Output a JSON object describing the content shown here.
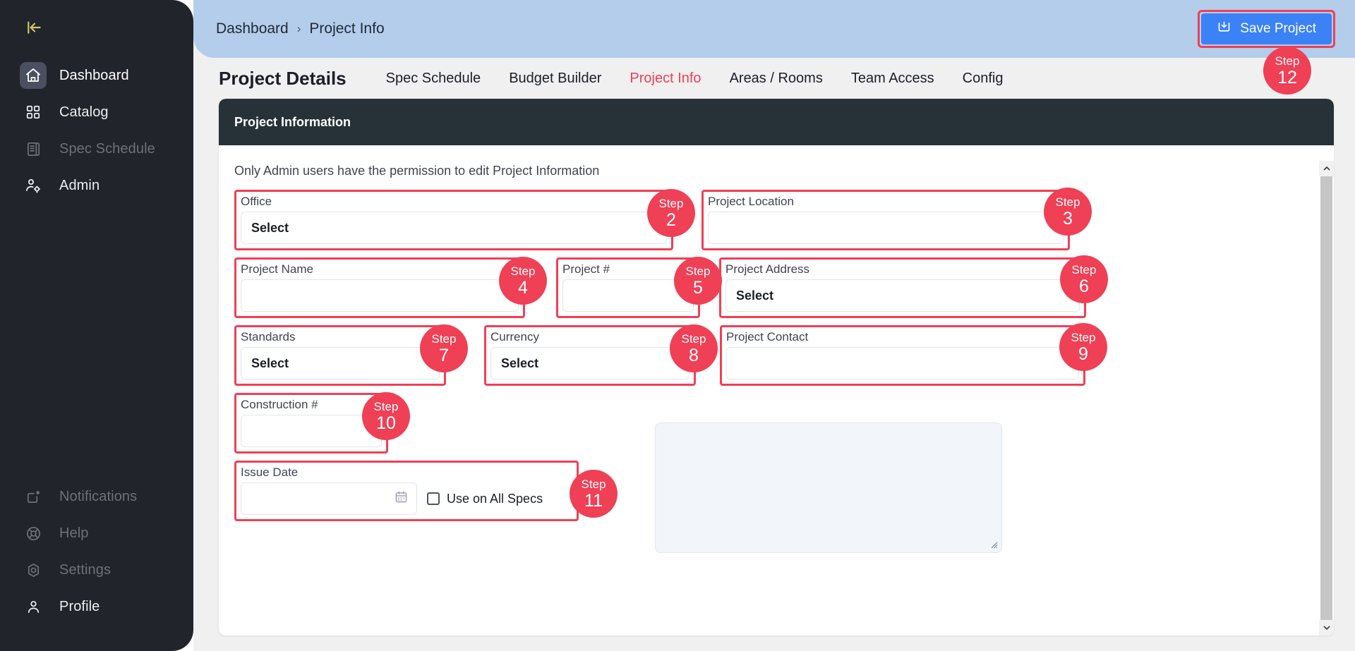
{
  "sidebar": {
    "collapse_icon": "collapse-panel-icon",
    "top_items": [
      {
        "label": "Dashboard",
        "icon": "home-icon",
        "state": "active"
      },
      {
        "label": "Catalog",
        "icon": "grid-icon",
        "state": "bright"
      },
      {
        "label": "Spec Schedule",
        "icon": "document-list-icon",
        "state": "dim"
      },
      {
        "label": "Admin",
        "icon": "user-gear-icon",
        "state": "bright"
      }
    ],
    "bottom_items": [
      {
        "label": "Notifications",
        "icon": "bell-notification-icon",
        "state": "dim"
      },
      {
        "label": "Help",
        "icon": "life-ring-icon",
        "state": "dim"
      },
      {
        "label": "Settings",
        "icon": "gear-icon",
        "state": "dim"
      },
      {
        "label": "Profile",
        "icon": "user-icon",
        "state": "bright"
      }
    ]
  },
  "header": {
    "breadcrumb": {
      "root": "Dashboard",
      "separator": "›",
      "current": "Project Info"
    },
    "save_button": {
      "label": "Save Project",
      "icon": "save-disk-icon"
    },
    "save_step": {
      "word": "Step",
      "num": "12"
    }
  },
  "tabs": {
    "title": "Project Details",
    "items": [
      {
        "label": "Spec Schedule",
        "selected": false
      },
      {
        "label": "Budget Builder",
        "selected": false
      },
      {
        "label": "Project Info",
        "selected": true
      },
      {
        "label": "Areas / Rooms",
        "selected": false
      },
      {
        "label": "Team Access",
        "selected": false
      },
      {
        "label": "Config",
        "selected": false
      }
    ]
  },
  "card": {
    "header_title": "Project Information",
    "permission_note": "Only Admin users have the permission to edit Project Information",
    "fields": {
      "office": {
        "label": "Office",
        "value": "Select",
        "step_word": "Step",
        "step_num": "2"
      },
      "project_location": {
        "label": "Project Location",
        "value": "",
        "step_word": "Step",
        "step_num": "3"
      },
      "project_name": {
        "label": "Project Name",
        "value": "",
        "step_word": "Step",
        "step_num": "4"
      },
      "project_number": {
        "label": "Project #",
        "value": "",
        "step_word": "Step",
        "step_num": "5"
      },
      "project_address": {
        "label": "Project Address",
        "value": "Select",
        "step_word": "Step",
        "step_num": "6"
      },
      "standards": {
        "label": "Standards",
        "value": "Select",
        "step_word": "Step",
        "step_num": "7"
      },
      "currency": {
        "label": "Currency",
        "value": "Select",
        "step_word": "Step",
        "step_num": "8"
      },
      "project_contact": {
        "label": "Project Contact",
        "value": "",
        "step_word": "Step",
        "step_num": "9"
      },
      "construction_number": {
        "label": "Construction #",
        "value": "",
        "step_word": "Step",
        "step_num": "10"
      },
      "issue_date": {
        "label": "Issue Date",
        "value": "",
        "calendar_icon": "calendar-icon",
        "checkbox_label": "Use on All Specs",
        "checkbox_checked": false,
        "step_word": "Step",
        "step_num": "11"
      },
      "notes": {
        "value": ""
      }
    }
  },
  "scrollbar": {
    "up_arrow": "chevron-up-icon",
    "down_arrow": "chevron-down-icon"
  },
  "colors": {
    "accent_red": "#ef4056",
    "primary_blue": "#3b82f6",
    "topbar_blue": "#b4cdeb",
    "sidebar_dark": "#21242a",
    "card_header_dark": "#263138"
  }
}
